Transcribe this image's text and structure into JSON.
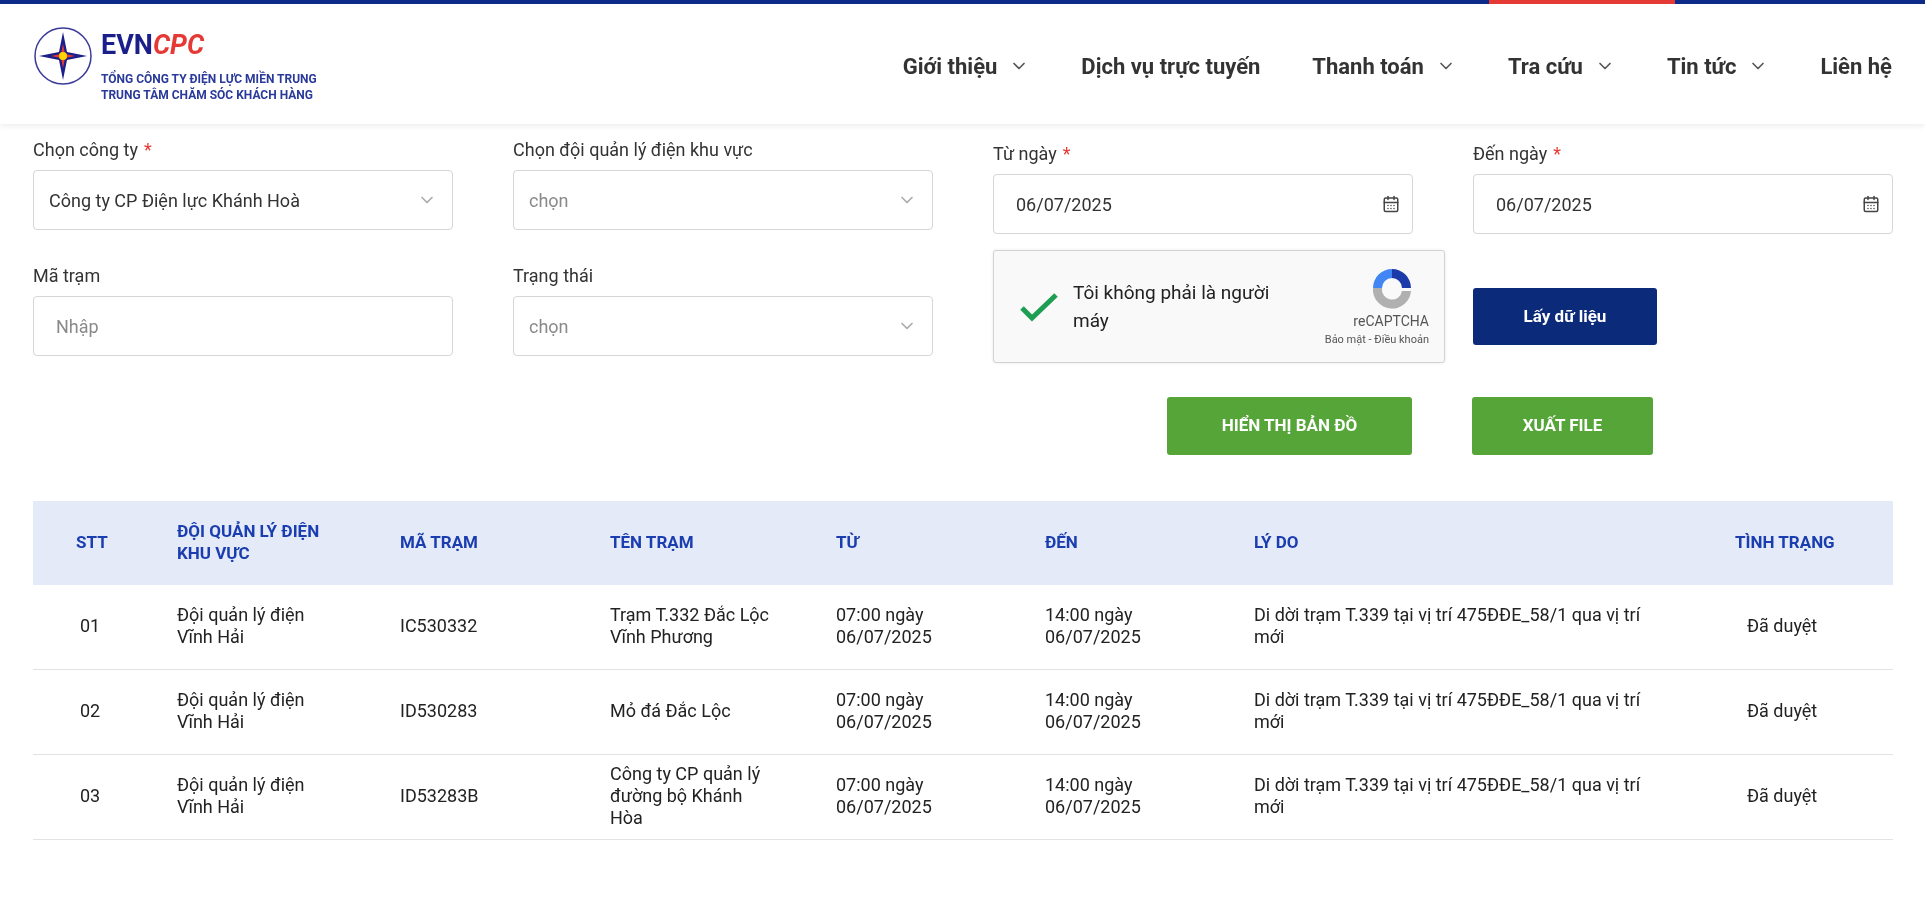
{
  "logo": {
    "brand_left": "EVN",
    "brand_right": "CPC",
    "line_1": "TỔNG CÔNG TY ĐIỆN LỰC MIỀN TRUNG",
    "line_2": "TRUNG TÂM CHĂM SÓC KHÁCH HÀNG"
  },
  "nav": [
    {
      "label": "Giới thiệu",
      "has_menu": true
    },
    {
      "label": "Dịch vụ trực tuyến",
      "has_menu": false
    },
    {
      "label": "Thanh toán",
      "has_menu": true
    },
    {
      "label": "Tra cứu",
      "has_menu": true
    },
    {
      "label": "Tin tức",
      "has_menu": true
    },
    {
      "label": "Liên hệ",
      "has_menu": false
    }
  ],
  "filters": [
    {
      "kind": "select",
      "label": "Chọn công ty",
      "required_mark": "*",
      "value": "Công ty CP Điện lực Khánh Hoà"
    },
    {
      "kind": "select",
      "label": "Chọn đội quản lý điện khu vực",
      "placeholder": "chọn"
    },
    {
      "kind": "date",
      "label": "Từ ngày",
      "required_mark": "*",
      "value": "06/07/2025"
    },
    {
      "kind": "date",
      "label": "Đến ngày",
      "required_mark": "*",
      "value": "06/07/2025"
    },
    {
      "kind": "text",
      "label": "Mã trạm",
      "placeholder": "Nhập"
    },
    {
      "kind": "select",
      "label": "Trạng thái",
      "placeholder": "chọn"
    }
  ],
  "captcha": {
    "checked": true,
    "label": "Tôi không phải là người máy",
    "brand": "reCAPTCHA",
    "links": "Bảo mật - Điều khoản"
  },
  "fetch_button": "Lấy dữ liệu",
  "action_buttons": [
    "HIỂN THỊ BẢN ĐỒ",
    "XUẤT FILE"
  ],
  "table": {
    "columns": [
      "STT",
      "ĐỘI QUẢN LÝ ĐIỆN KHU VỰC",
      "MÃ TRẠM",
      "TÊN TRẠM",
      "TỪ",
      "ĐẾN",
      "LÝ DO",
      "TÌNH TRẠNG"
    ],
    "rows": [
      [
        "01",
        "Đội quản lý điện Vĩnh Hải",
        "IC530332",
        "Trạm T.332 Đắc Lộc Vĩnh Phương",
        "07:00 ngày 06/07/2025",
        "14:00 ngày 06/07/2025",
        "Di dời trạm T.339 tại vị trí 475ĐĐE_58/1 qua vị trí mới",
        "Đã duyệt"
      ],
      [
        "02",
        "Đội quản lý điện Vĩnh Hải",
        "ID530283",
        "Mỏ đá Đắc Lộc",
        "07:00 ngày 06/07/2025",
        "14:00 ngày 06/07/2025",
        "Di dời trạm T.339 tại vị trí 475ĐĐE_58/1 qua vị trí mới",
        "Đã duyệt"
      ],
      [
        "03",
        "Đội quản lý điện Vĩnh Hải",
        "ID53283B",
        "Công ty CP quản lý đường bộ Khánh Hòa",
        "07:00 ngày 06/07/2025",
        "14:00 ngày 06/07/2025",
        "Di dời trạm T.339 tại vị trí 475ĐĐE_58/1 qua vị trí mới",
        "Đã duyệt"
      ]
    ]
  }
}
